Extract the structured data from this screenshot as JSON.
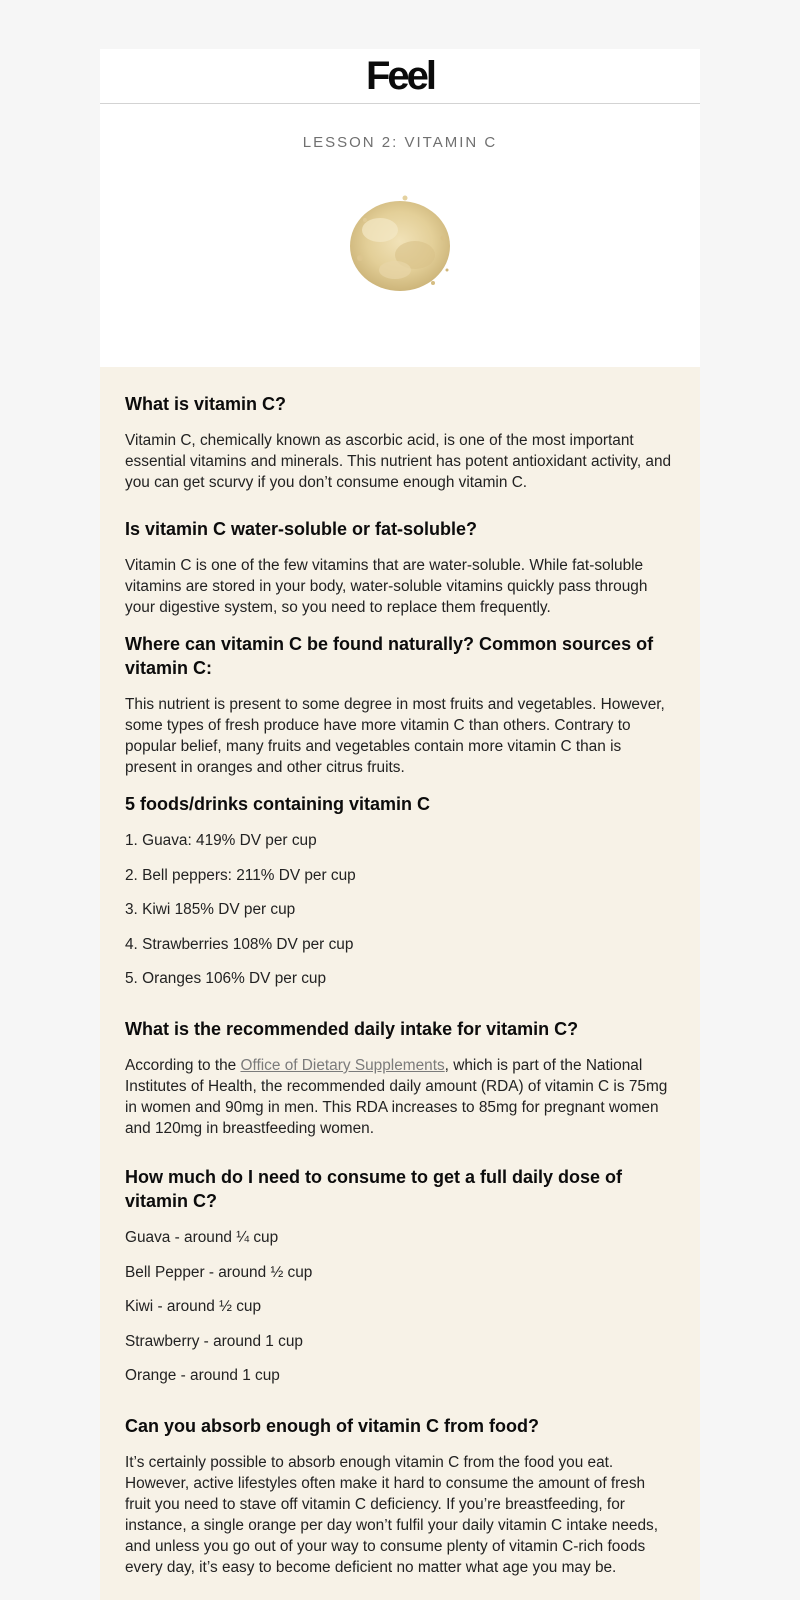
{
  "brand": {
    "logo_text": "Feel"
  },
  "lesson": {
    "title": "LESSON 2: VITAMIN C"
  },
  "image": {
    "icon": "vitamin-c-powder-image"
  },
  "colors": {
    "content_bg": "#f7f2e7",
    "header_bg": "#ffffff",
    "page_bg": "#f6f6f6",
    "link": "#7b7b7b"
  },
  "sections": {
    "what_is": {
      "heading": "What is vitamin C?",
      "body": "Vitamin C, chemically known as ascorbic acid, is one of the most important essential vitamins and minerals. This nutrient has potent antioxidant activity, and you can get scurvy if you don’t consume enough vitamin C."
    },
    "soluble": {
      "heading": "Is vitamin C water-soluble or fat-soluble?",
      "body": "Vitamin C is one of the few vitamins that are water-soluble. While fat-soluble vitamins are stored in your body, water-soluble vitamins quickly pass through your digestive system, so you need to replace them frequently."
    },
    "sources": {
      "heading": "Where can vitamin C be found naturally? Common sources of vitamin C:",
      "body": "This nutrient is present to some degree in most fruits and vegetables. However, some types of fresh produce have more vitamin C than others. Contrary to popular belief, many fruits and vegetables contain more vitamin C than is present in oranges and other citrus fruits."
    },
    "foods": {
      "heading": "5 foods/drinks containing vitamin C",
      "items": [
        "1. Guava: 419% DV per cup",
        "2. Bell peppers: 211% DV per cup",
        "3. Kiwi 185% DV per cup",
        "4. Strawberries 108% DV per cup",
        "5. Oranges 106% DV per cup"
      ]
    },
    "intake": {
      "heading": "What is the recommended daily intake for vitamin C?",
      "body_before": "According to the ",
      "link_text": "Office of Dietary Supplements",
      "body_after": ", which is part of the National Institutes of Health, the recommended daily amount (RDA) of vitamin C is 75mg in women and 90mg in men. This RDA increases to 85mg for pregnant women and 120mg in breastfeeding women."
    },
    "dose": {
      "heading": "How much do I need to consume to get a full daily dose of vitamin C?",
      "items": [
        "Guava - around ¼ cup",
        "Bell Pepper - around ½ cup",
        "Kiwi - around ½ cup",
        "Strawberry  - around 1 cup",
        "Orange  - around 1 cup"
      ]
    },
    "absorb": {
      "heading": "Can you absorb enough of vitamin C from food?",
      "body": "It’s certainly possible to absorb enough vitamin C from the food you eat. However, active lifestyles often make it hard to consume the amount of fresh fruit you need to stave off vitamin C deficiency. If you’re breastfeeding, for instance, a single orange per day won’t fulfil your daily vitamin C intake needs, and unless you go out of your way to consume plenty of vitamin C-rich foods every day, it’s easy to become deficient no matter what age you may be."
    }
  }
}
